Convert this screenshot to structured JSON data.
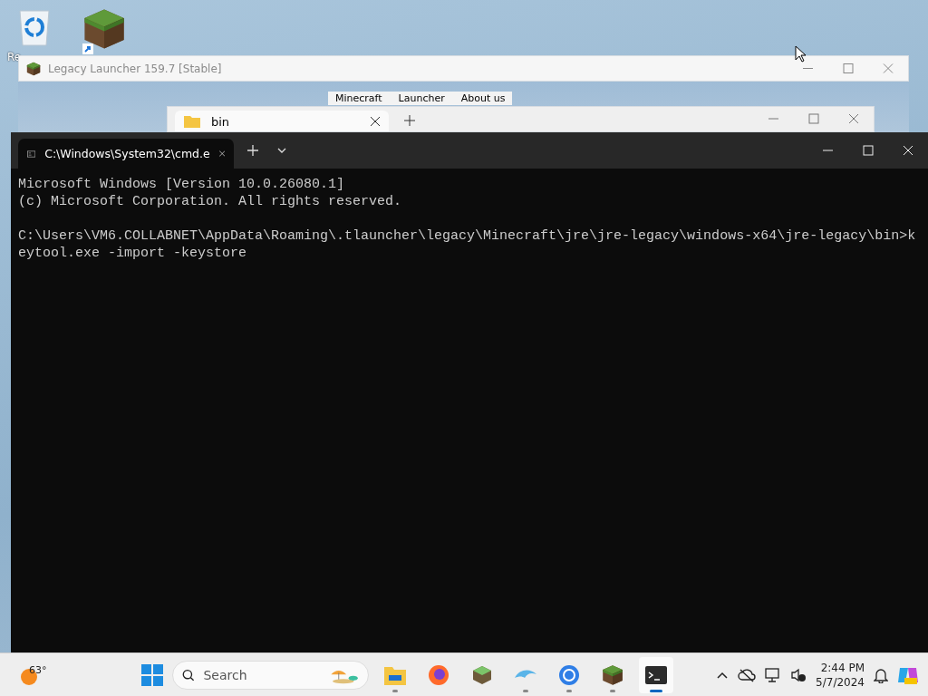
{
  "desktop": {
    "icons": [
      {
        "kind": "recycle",
        "label": "Re"
      },
      {
        "kind": "block"
      }
    ]
  },
  "launcher": {
    "title": "Legacy Launcher 159.7 [Stable]",
    "menu": [
      "Minecraft",
      "Launcher",
      "About us"
    ]
  },
  "explorer": {
    "tab": "bin"
  },
  "terminal": {
    "tab_title": "C:\\Windows\\System32\\cmd.e",
    "blocks": [
      [
        "Microsoft Windows [Version 10.0.26080.1]",
        "(c) Microsoft Corporation. All rights reserved."
      ],
      [
        "C:\\Users\\VM6.COLLABNET\\AppData\\Roaming\\.tlauncher\\legacy\\Minecraft\\jre\\jre-legacy\\windows-x64\\jre-legacy\\bin>k",
        "eytool.exe -import -keystore"
      ]
    ]
  },
  "taskbar": {
    "weather": "63°",
    "search": {
      "placeholder": "Search"
    },
    "apps": [
      {
        "kind": "folder",
        "running": true,
        "selected": false
      },
      {
        "kind": "firefox",
        "running": false,
        "selected": false
      },
      {
        "kind": "map",
        "running": false,
        "selected": false
      },
      {
        "kind": "dolphin",
        "running": true,
        "selected": false
      },
      {
        "kind": "chrome",
        "running": true,
        "selected": false
      },
      {
        "kind": "block",
        "running": true,
        "selected": false
      },
      {
        "kind": "terminal",
        "running": true,
        "selected": true
      }
    ],
    "time": "2:44 PM",
    "date": "5/7/2024"
  }
}
